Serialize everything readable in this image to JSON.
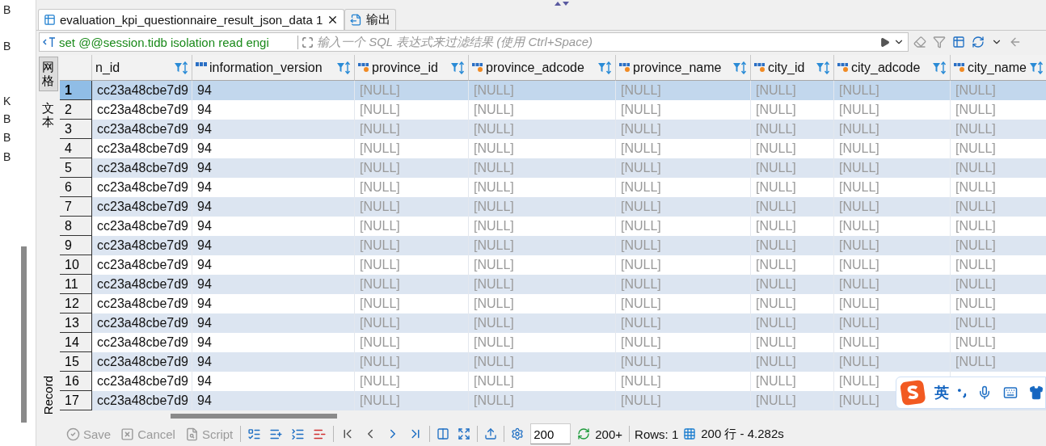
{
  "left_panel": {
    "sizes": [
      "B",
      "B",
      "K",
      "B",
      "B",
      "B"
    ]
  },
  "editor_tabs": [
    {
      "label": "evaluation_kpi_questionnaire_result_json_data 1",
      "selected": true,
      "closable": true
    },
    {
      "label": "输出",
      "selected": false,
      "closable": false
    }
  ],
  "filter": {
    "value": "set @@session.tidb isolation read engi",
    "placeholder": "输入一个 SQL 表达式来过滤结果 (使用 Ctrl+Space)"
  },
  "side_tabs": [
    {
      "label": "网格",
      "kind": "cjk",
      "selected": true
    },
    {
      "label": "文本",
      "kind": "cjk",
      "selected": false
    },
    {
      "label": "Record",
      "kind": "latin",
      "selected": false
    }
  ],
  "table": {
    "columns": [
      {
        "label": "n_id",
        "kind": "plain",
        "greyed": false
      },
      {
        "label": "information_version",
        "kind": "abc",
        "greyed": false
      },
      {
        "label": "province_id",
        "kind": "abc-dot",
        "greyed": true
      },
      {
        "label": "province_adcode",
        "kind": "abc-dot",
        "greyed": true
      },
      {
        "label": "province_name",
        "kind": "abc-dot",
        "greyed": true
      },
      {
        "label": "city_id",
        "kind": "abc-dot",
        "greyed": true
      },
      {
        "label": "city_adcode",
        "kind": "abc-dot",
        "greyed": true
      },
      {
        "label": "city_name",
        "kind": "abc-dot",
        "greyed": true
      }
    ],
    "rows": [
      {
        "number": "1",
        "selected": true,
        "cells": [
          "cc23a48cbe7d9",
          "94",
          "[NULL]",
          "[NULL]",
          "[NULL]",
          "[NULL]",
          "[NULL]",
          "[NULL]"
        ]
      },
      {
        "number": "2",
        "selected": false,
        "cells": [
          "cc23a48cbe7d9",
          "94",
          "[NULL]",
          "[NULL]",
          "[NULL]",
          "[NULL]",
          "[NULL]",
          "[NULL]"
        ]
      },
      {
        "number": "3",
        "selected": false,
        "cells": [
          "cc23a48cbe7d9",
          "94",
          "[NULL]",
          "[NULL]",
          "[NULL]",
          "[NULL]",
          "[NULL]",
          "[NULL]"
        ]
      },
      {
        "number": "4",
        "selected": false,
        "cells": [
          "cc23a48cbe7d9",
          "94",
          "[NULL]",
          "[NULL]",
          "[NULL]",
          "[NULL]",
          "[NULL]",
          "[NULL]"
        ]
      },
      {
        "number": "5",
        "selected": false,
        "cells": [
          "cc23a48cbe7d9",
          "94",
          "[NULL]",
          "[NULL]",
          "[NULL]",
          "[NULL]",
          "[NULL]",
          "[NULL]"
        ]
      },
      {
        "number": "6",
        "selected": false,
        "cells": [
          "cc23a48cbe7d9",
          "94",
          "[NULL]",
          "[NULL]",
          "[NULL]",
          "[NULL]",
          "[NULL]",
          "[NULL]"
        ]
      },
      {
        "number": "7",
        "selected": false,
        "cells": [
          "cc23a48cbe7d9",
          "94",
          "[NULL]",
          "[NULL]",
          "[NULL]",
          "[NULL]",
          "[NULL]",
          "[NULL]"
        ]
      },
      {
        "number": "8",
        "selected": false,
        "cells": [
          "cc23a48cbe7d9",
          "94",
          "[NULL]",
          "[NULL]",
          "[NULL]",
          "[NULL]",
          "[NULL]",
          "[NULL]"
        ]
      },
      {
        "number": "9",
        "selected": false,
        "cells": [
          "cc23a48cbe7d9",
          "94",
          "[NULL]",
          "[NULL]",
          "[NULL]",
          "[NULL]",
          "[NULL]",
          "[NULL]"
        ]
      },
      {
        "number": "10",
        "selected": false,
        "cells": [
          "cc23a48cbe7d9",
          "94",
          "[NULL]",
          "[NULL]",
          "[NULL]",
          "[NULL]",
          "[NULL]",
          "[NULL]"
        ]
      },
      {
        "number": "11",
        "selected": false,
        "cells": [
          "cc23a48cbe7d9",
          "94",
          "[NULL]",
          "[NULL]",
          "[NULL]",
          "[NULL]",
          "[NULL]",
          "[NULL]"
        ]
      },
      {
        "number": "12",
        "selected": false,
        "cells": [
          "cc23a48cbe7d9",
          "94",
          "[NULL]",
          "[NULL]",
          "[NULL]",
          "[NULL]",
          "[NULL]",
          "[NULL]"
        ]
      },
      {
        "number": "13",
        "selected": false,
        "cells": [
          "cc23a48cbe7d9",
          "94",
          "[NULL]",
          "[NULL]",
          "[NULL]",
          "[NULL]",
          "[NULL]",
          "[NULL]"
        ]
      },
      {
        "number": "14",
        "selected": false,
        "cells": [
          "cc23a48cbe7d9",
          "94",
          "[NULL]",
          "[NULL]",
          "[NULL]",
          "[NULL]",
          "[NULL]",
          "[NULL]"
        ]
      },
      {
        "number": "15",
        "selected": false,
        "cells": [
          "cc23a48cbe7d9",
          "94",
          "[NULL]",
          "[NULL]",
          "[NULL]",
          "[NULL]",
          "[NULL]",
          "[NULL]"
        ]
      },
      {
        "number": "16",
        "selected": false,
        "cells": [
          "cc23a48cbe7d9",
          "94",
          "[NULL]",
          "[NULL]",
          "[NULL]",
          "[NULL]",
          "[NULL]"
        ]
      },
      {
        "number": "17",
        "selected": false,
        "cells": [
          "cc23a48cbe7d9",
          "94",
          "[NULL]",
          "[NULL]",
          "[NULL]",
          "[NULL]",
          "[NULL]"
        ]
      }
    ]
  },
  "bottom_toolbar": {
    "actions": [
      {
        "label": "Save",
        "kind": "save",
        "disabled": true
      },
      {
        "label": "Cancel",
        "kind": "cancel",
        "disabled": true
      },
      {
        "label": "Script",
        "kind": "script",
        "disabled": true
      }
    ],
    "fetch_size": "200",
    "fetch_more": "200+",
    "rows": "Rows: 1",
    "summary": "200 行 - 4.282s"
  },
  "ime": {
    "mode": "英"
  }
}
